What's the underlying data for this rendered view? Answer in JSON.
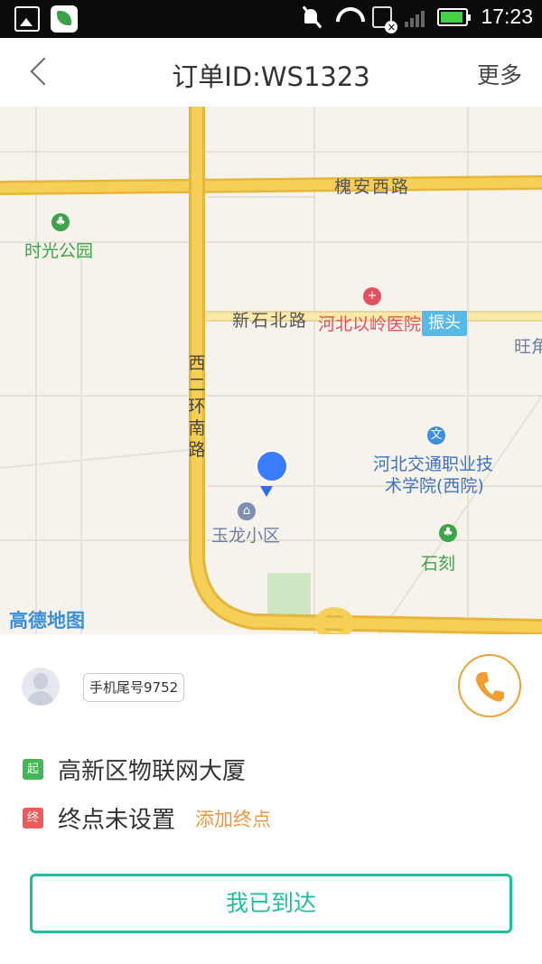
{
  "status_bar": {
    "time": "17:23",
    "icons": [
      "gallery-icon",
      "app-icon",
      "mute-icon",
      "wifi-icon",
      "sim-off-icon",
      "signal-icon",
      "battery-icon"
    ]
  },
  "header": {
    "title": "订单ID:WS1323",
    "more_label": "更多",
    "back_icon": "chevron-left-icon"
  },
  "map": {
    "roads": {
      "huaian_west": "槐安西路",
      "xinshi_north": "新石北路",
      "west_2nd_ring": [
        "西",
        "二",
        "环",
        "南",
        "路"
      ]
    },
    "pois": {
      "park": "时光公园",
      "hospital": "河北以岭医院",
      "college_line1": "河北交通职业技",
      "college_line2": "术学院(西院)",
      "community": "玉龙小区",
      "shike": "石刻",
      "zhentou": "振头",
      "wang": "旺角"
    },
    "logo": "高德地图",
    "colors": {
      "road_major": "#f5c33b",
      "background": "#f6f3ec",
      "location": "#3b7cff"
    }
  },
  "info": {
    "phone_tag": "手机尾号9752",
    "start_tag": "起",
    "start_address": "高新区物联网大厦",
    "end_tag": "终",
    "end_address": "终点未设置",
    "add_end_label": "添加终点",
    "arrive_label": "我已到达"
  }
}
